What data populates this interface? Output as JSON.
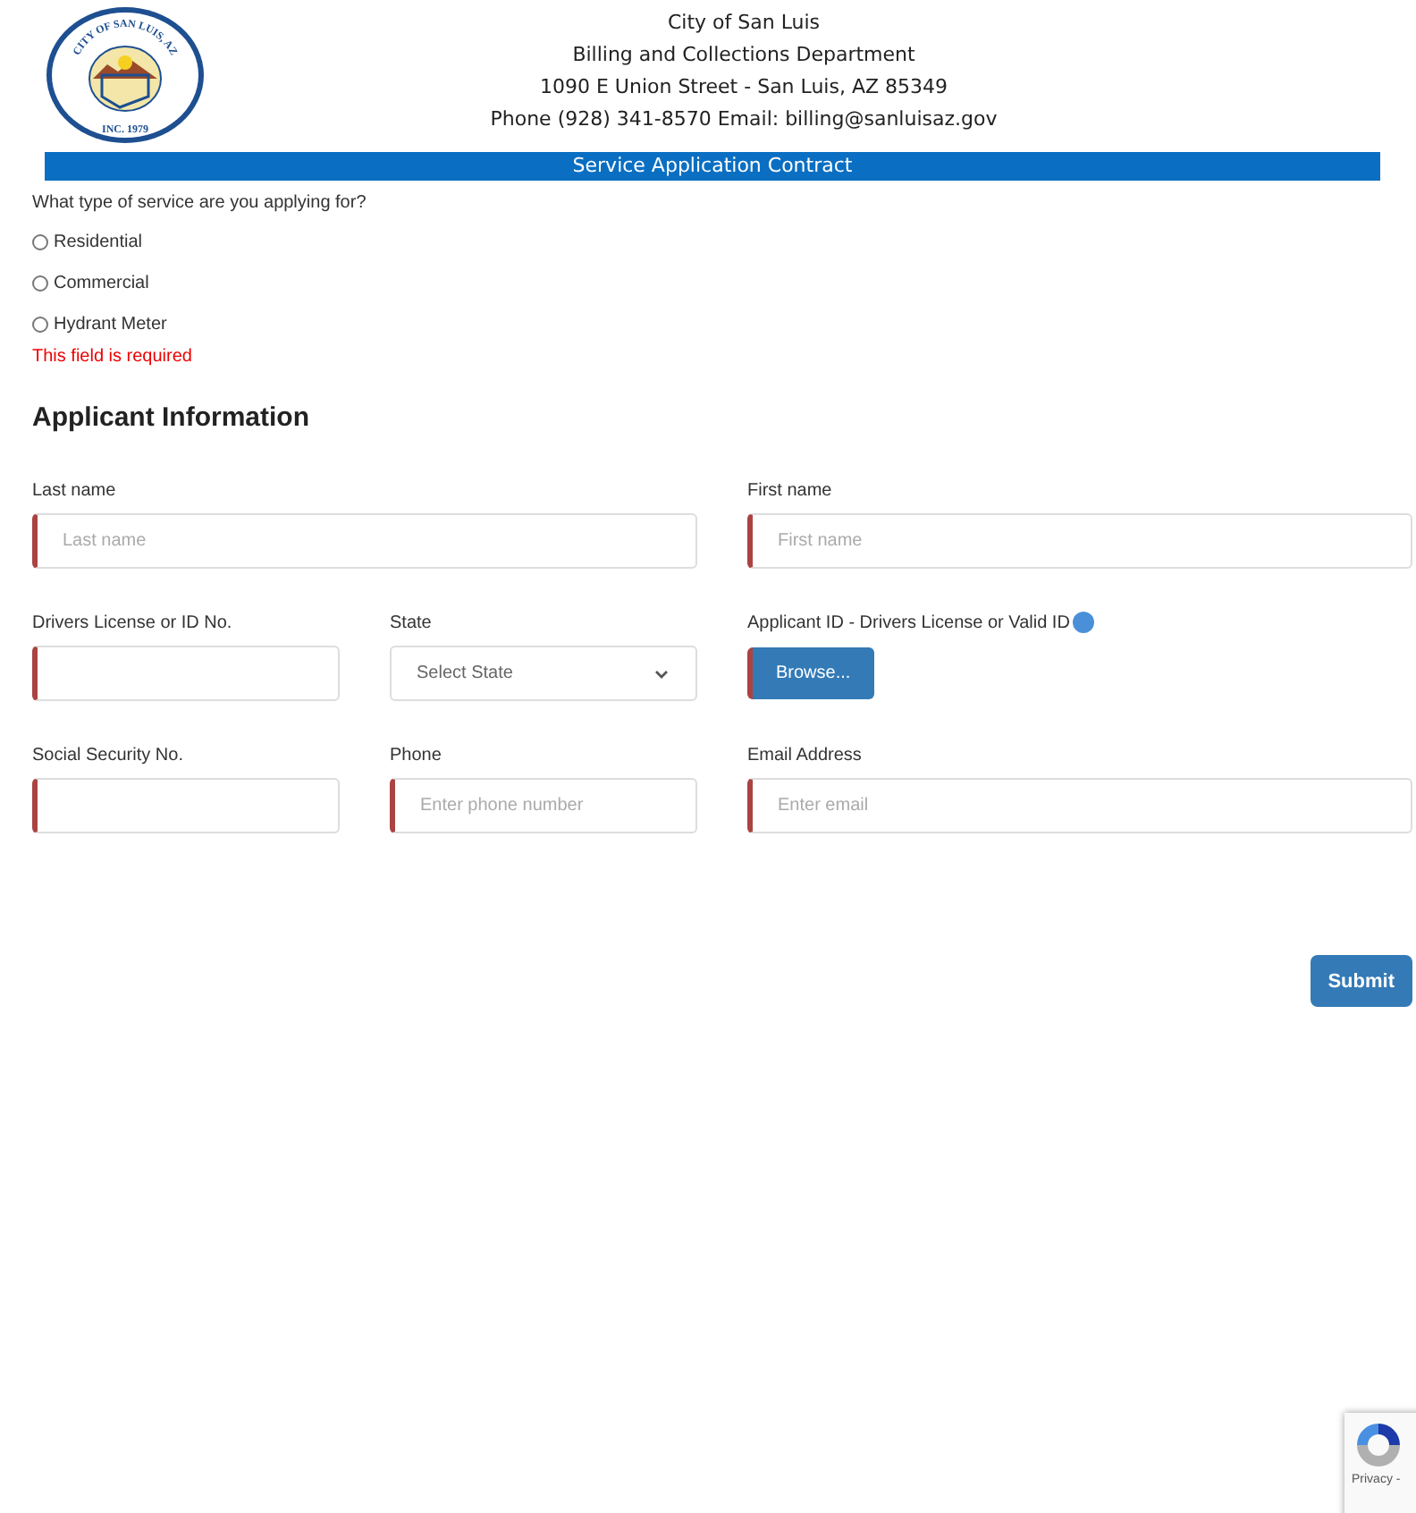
{
  "header": {
    "seal": {
      "top_text": "CITY OF SAN LUIS, AZ",
      "bottom_text": "INC. 1979"
    },
    "lines": [
      "City of San Luis",
      "Billing and Collections Department",
      "1090 E Union Street - San Luis, AZ 85349",
      "Phone (928) 341-8570 Email: billing@sanluisaz.gov"
    ],
    "banner": "Service Application Contract"
  },
  "service_question": {
    "label": "What type of service are you applying for?",
    "options": [
      {
        "label": "Residential",
        "selected": false
      },
      {
        "label": "Commercial",
        "selected": false
      },
      {
        "label": "Hydrant Meter",
        "selected": false
      }
    ],
    "error": "This field is required"
  },
  "section_title": "Applicant Information",
  "rows": [
    [
      {
        "kind": "text",
        "label": "Last name",
        "placeholder": "Last name",
        "required": true
      },
      {
        "kind": "text",
        "label": "First name",
        "placeholder": "First name",
        "required": true
      }
    ],
    [
      {
        "kind": "text",
        "label": "Drivers License or ID No.",
        "required": true
      },
      {
        "kind": "select",
        "label": "State",
        "value": "Select State",
        "required": false
      },
      {
        "kind": "file",
        "label": "Applicant ID - Drivers License or Valid ID",
        "button": "Browse...",
        "required": true
      }
    ],
    [
      {
        "kind": "text",
        "label": "Social Security No.",
        "required": true
      },
      {
        "kind": "text",
        "label": "Phone",
        "placeholder": "Enter phone number",
        "required": true
      },
      {
        "kind": "text",
        "label": "Email Address",
        "placeholder": "Enter email",
        "required": true
      }
    ]
  ],
  "submit": "Submit",
  "recaptcha": {
    "text": "Privacy -"
  }
}
